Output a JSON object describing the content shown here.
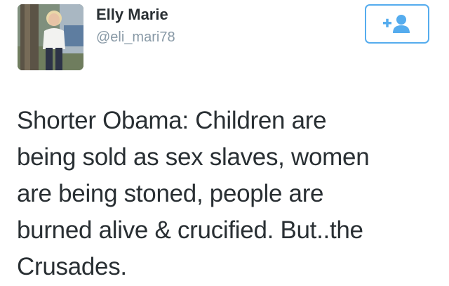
{
  "user": {
    "display_name": "Elly Marie",
    "handle": "@eli_mari78",
    "avatar_icon": "profile-photo"
  },
  "follow_button": {
    "icon": "add-user-icon",
    "accent_color": "#55acee"
  },
  "tweet": {
    "lines": [
      "Shorter Obama: Children are",
      "being sold as sex slaves, women",
      "are being stoned, people are",
      "burned alive & crucified. But..the",
      "Crusades."
    ]
  }
}
